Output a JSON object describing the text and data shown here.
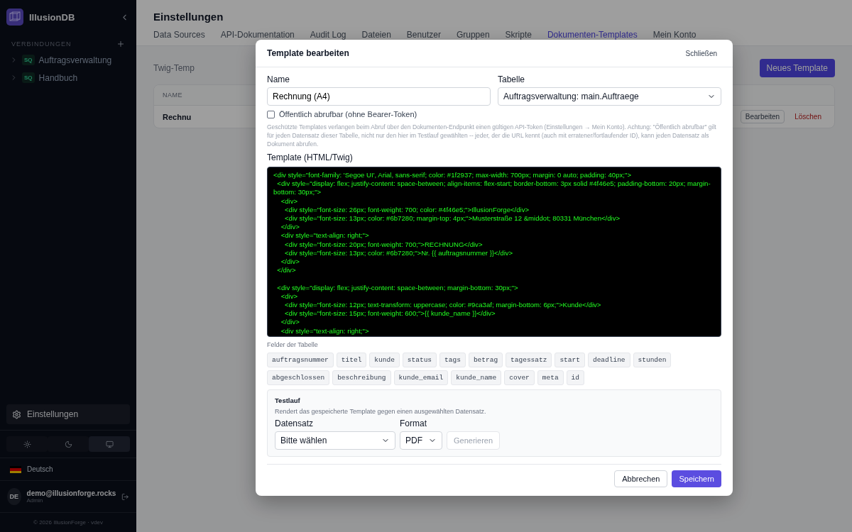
{
  "app": {
    "name": "IllusionDB",
    "copyright": "© 2026 IllusionForge · vdev"
  },
  "sidebar": {
    "section": "VERBINDUNGEN",
    "connections": [
      {
        "badge": "SQ",
        "name": "Auftragsverwaltung",
        "expanded": false
      },
      {
        "badge": "SQ",
        "name": "Handbuch",
        "expanded": false
      }
    ],
    "settings": "Einstellungen",
    "themes": [
      {
        "kind": "light",
        "selected": false
      },
      {
        "kind": "dark",
        "selected": false
      },
      {
        "kind": "system",
        "selected": true
      }
    ],
    "language": "Deutsch",
    "user": {
      "initials": "DE",
      "email": "demo@illusionforge.rocks",
      "role": "Admin"
    }
  },
  "page": {
    "title": "Einstellungen",
    "tabs": [
      {
        "label": "Data Sources",
        "selected": false
      },
      {
        "label": "API-Dokumentation",
        "selected": false
      },
      {
        "label": "Audit Log",
        "selected": false
      },
      {
        "label": "Dateien",
        "selected": false
      },
      {
        "label": "Benutzer",
        "selected": false
      },
      {
        "label": "Gruppen",
        "selected": false
      },
      {
        "label": "Skripte",
        "selected": false
      },
      {
        "label": "Dokumenten-Templates",
        "selected": true
      },
      {
        "label": "Mein Konto",
        "selected": false
      }
    ],
    "intro": "Twig-Temp",
    "new_button": "Neues Template",
    "table": {
      "columns": [
        "NAME"
      ],
      "rows": [
        {
          "name": "Rechnu",
          "edit": "Bearbeiten",
          "delete": "Löschen"
        }
      ]
    }
  },
  "modal": {
    "title": "Template bearbeiten",
    "close": "Schließen",
    "name_label": "Name",
    "name_value": "Rechnung (A4)",
    "table_label": "Tabelle",
    "table_value": "Auftragsverwaltung: main.Auftraege",
    "public": {
      "label": "Öffentlich abrufbar (ohne Bearer-Token)",
      "checked": false
    },
    "help": "Geschützte Templates verlangen beim Abruf über den Dokumenten-Endpunkt einen gültigen API-Token (Einstellungen → Mein Konto). Achtung: \"Öffentlich abrufbar\" gilt für jeden Datensatz dieser Tabelle, nicht nur den hier im Testlauf gewählten -- jeder, der die URL kennt (auch mit erratener/fortlaufender ID), kann jeden Datensatz als Dokument abrufen.",
    "template_label": "Template (HTML/Twig)",
    "template": "<div style=\"font-family: 'Segoe UI', Arial, sans-serif; color: #1f2937; max-width: 700px; margin: 0 auto; padding: 40px;\">\n  <div style=\"display: flex; justify-content: space-between; align-items: flex-start; border-bottom: 3px solid #4f46e5; padding-bottom: 20px; margin-bottom: 30px;\">\n    <div>\n      <div style=\"font-size: 26px; font-weight: 700; color: #4f46e5;\">IllusionForge</div>\n      <div style=\"font-size: 13px; color: #6b7280; margin-top: 4px;\">Musterstraße 12 &middot; 80331 München</div>\n    </div>\n    <div style=\"text-align: right;\">\n      <div style=\"font-size: 20px; font-weight: 700;\">RECHNUNG</div>\n      <div style=\"font-size: 13px; color: #6b7280;\">Nr. {{ auftragsnummer }}</div>\n    </div>\n  </div>\n\n  <div style=\"display: flex; justify-content: space-between; margin-bottom: 30px;\">\n    <div>\n      <div style=\"font-size: 12px; text-transform: uppercase; color: #9ca3af; margin-bottom: 6px;\">Kunde</div>\n      <div style=\"font-size: 15px; font-weight: 600;\">{{ kunde_name }}</div>\n    </div>\n    <div style=\"text-align: right;\">",
    "fields_label": "Felder der Tabelle",
    "fields": [
      "auftragsnummer",
      "titel",
      "kunde",
      "status",
      "tags",
      "betrag",
      "tagessatz",
      "start",
      "deadline",
      "stunden",
      "abgeschlossen",
      "beschreibung",
      "kunde_email",
      "kunde_name",
      "cover",
      "meta",
      "id"
    ],
    "test": {
      "title": "Testlauf",
      "hint": "Rendert das gespeicherte Template gegen einen ausgewählten Datensatz.",
      "record_label": "Datensatz",
      "record_value": "Bitte wählen",
      "format_label": "Format",
      "format_value": "PDF",
      "generate": {
        "label": "Generieren",
        "disabled": true
      }
    },
    "cancel": "Abbrechen",
    "save": "Speichern"
  }
}
